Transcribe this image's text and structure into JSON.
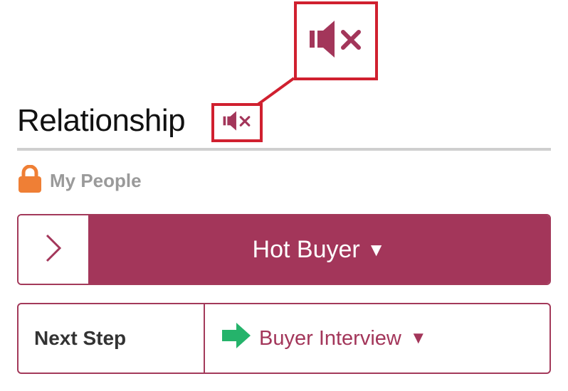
{
  "header": {
    "title": "Relationship",
    "mute_icon": "speaker-muted-icon"
  },
  "privacy": {
    "icon": "lock-icon",
    "label": "My People",
    "icon_color": "#ef7f35"
  },
  "status": {
    "expand_icon": "chevron-right-icon",
    "value": "Hot Buyer",
    "caret": "▼",
    "color": "#a3365a"
  },
  "next_step": {
    "label": "Next Step",
    "icon": "arrow-right-icon",
    "icon_color": "#25b36b",
    "value": "Buyer Interview",
    "caret": "▼"
  },
  "colors": {
    "accent": "#a3365a",
    "callout": "#d0202f",
    "divider": "#cfcfcf"
  }
}
